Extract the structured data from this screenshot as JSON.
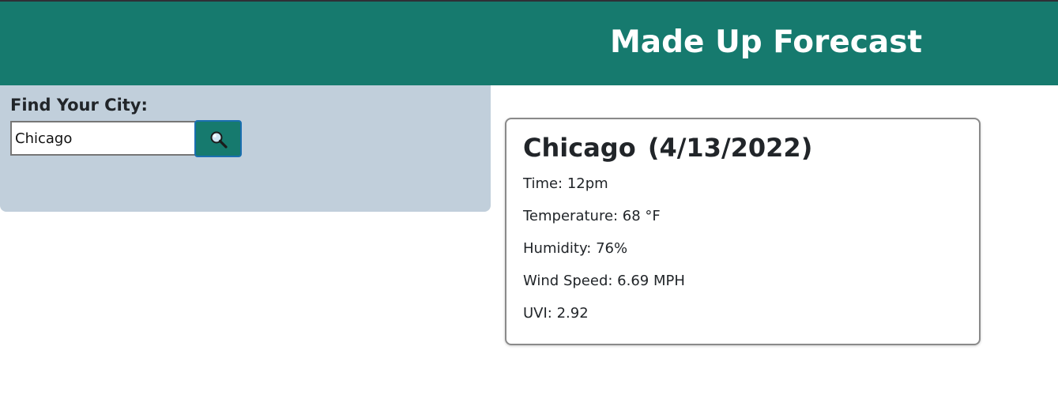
{
  "header": {
    "title": "Made Up Forecast"
  },
  "search": {
    "label": "Find Your City:",
    "value": "Chicago",
    "button_icon": "magnifying-glass-icon"
  },
  "current": {
    "city": "Chicago",
    "date": "(4/13/2022)",
    "stats": [
      {
        "label": "Time:",
        "value": "12pm",
        "text": "Time: 12pm"
      },
      {
        "label": "Temperature:",
        "value": "68 °F",
        "text": "Temperature: 68 °F"
      },
      {
        "label": "Humidity:",
        "value": "76%",
        "text": "Humidity: 76%"
      },
      {
        "label": "Wind Speed:",
        "value": "6.69 MPH",
        "text": "Wind Speed: 6.69 MPH"
      },
      {
        "label": "UVI:",
        "value": "2.92",
        "text": "UVI: 2.92"
      }
    ]
  },
  "colors": {
    "header_bg": "#167a6e",
    "panel_bg": "#c1cfdb",
    "button_bg": "#167a6e"
  }
}
